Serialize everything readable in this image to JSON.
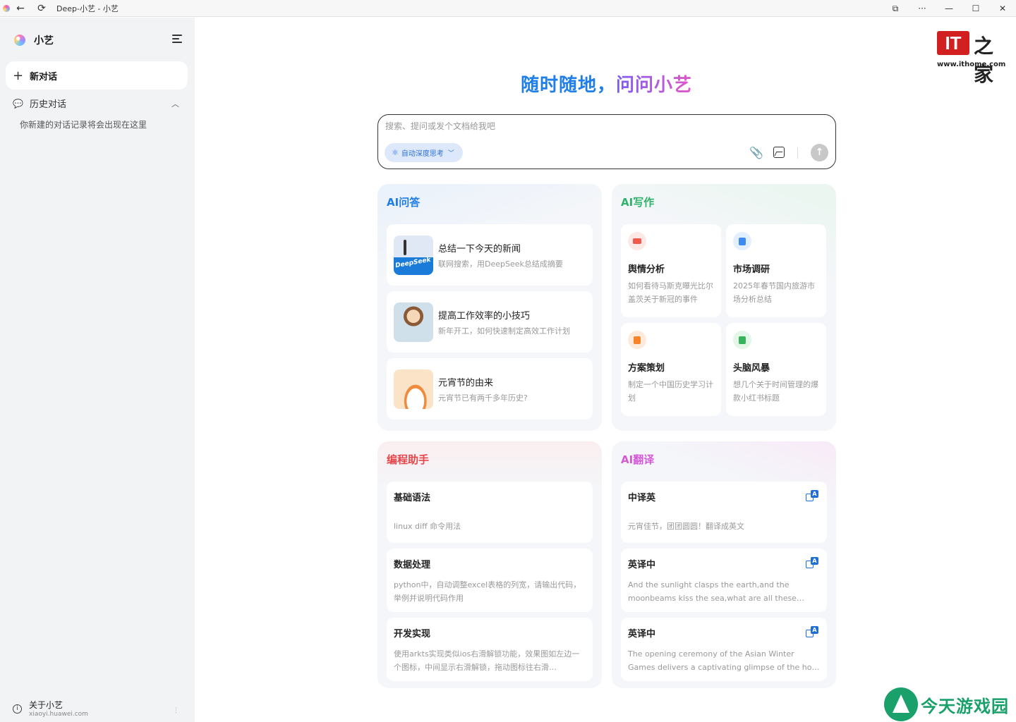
{
  "window": {
    "title": "Deep-小艺 - 小艺"
  },
  "sidebar": {
    "app_name": "小艺",
    "new_chat": "新对话",
    "history_label": "历史对话",
    "history_empty": "你新建的对话记录将会出现在这里",
    "about_title": "关于小艺",
    "about_url": "xiaoyi.huawei.com"
  },
  "watermark": {
    "it_box": "IT",
    "it_cn": "之家",
    "url": "www.ithome.com",
    "bottom": "今天游戏园"
  },
  "hero": {
    "part1": "随时随地，",
    "part2": "问问小艺"
  },
  "search": {
    "placeholder": "搜索、提问或发个文档给我吧",
    "chip": "自动深度思考"
  },
  "colors": {
    "qa": "#1f7ee8",
    "writing": "#2fb36a",
    "coding": "#e8454a",
    "translate": "#d55ad9"
  },
  "qa": {
    "title": "AI问答",
    "items": [
      {
        "title": "总结一下今天的新闻",
        "sub": "联网搜索，用DeepSeek总结成摘要",
        "thumb_text": "DeepSeek"
      },
      {
        "title": "提高工作效率的小技巧",
        "sub": "新年开工，如何快速制定高效工作计划"
      },
      {
        "title": "元宵节的由来",
        "sub": "元宵节已有两千多年历史?"
      }
    ]
  },
  "writing": {
    "title": "AI写作",
    "items": [
      {
        "title": "舆情分析",
        "sub": "如何看待马斯克曝光比尔盖茨关于新冠的事件",
        "icon": "opinion-icon"
      },
      {
        "title": "市场调研",
        "sub": "2025年春节国内旅游市场分析总结",
        "icon": "document-icon"
      },
      {
        "title": "方案策划",
        "sub": "制定一个中国历史学习计划",
        "icon": "plan-icon"
      },
      {
        "title": "头脑风暴",
        "sub": "想几个关于时间管理的爆款小红书标题",
        "icon": "brainstorm-icon"
      }
    ]
  },
  "coding": {
    "title": "编程助手",
    "items": [
      {
        "title": "基础语法",
        "sub": "linux diff 命令用法"
      },
      {
        "title": "数据处理",
        "sub": "python中，自动调整excel表格的列宽，请输出代码，举例并说明代码作用"
      },
      {
        "title": "开发实现",
        "sub": "使用arkts实现类似ios右滑解锁功能，效果图如左边一个图标，中间显示右滑解锁，拖动图标往右滑…"
      }
    ]
  },
  "translate": {
    "title": "AI翻译",
    "items": [
      {
        "title": "中译英",
        "sub": "元宵佳节，团团圆圆！翻译成英文"
      },
      {
        "title": "英译中",
        "sub": "And the sunlight clasps the earth,and the moonbeams kiss the sea,what are all these…"
      },
      {
        "title": "英译中",
        "sub": "The opening ceremony of the Asian Winter Games delivers a captivating glimpse of the host city's…"
      }
    ]
  }
}
